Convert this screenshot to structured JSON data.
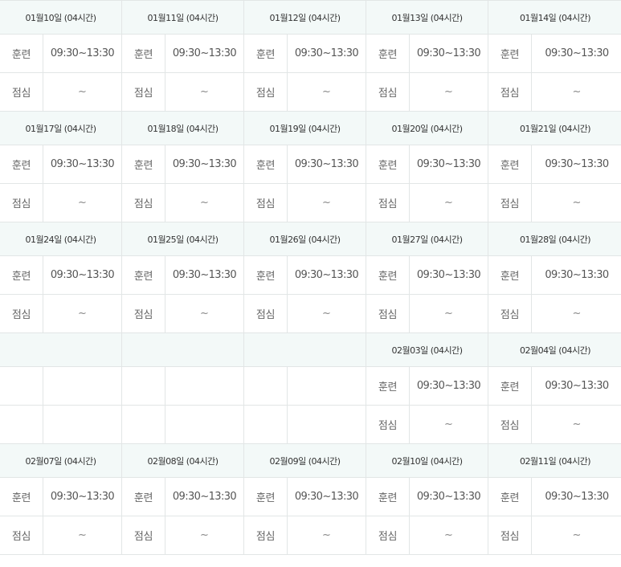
{
  "labels": {
    "training": "훈련",
    "lunch": "점심"
  },
  "weeks": [
    {
      "days": [
        {
          "date": "01월10일 (04시간)",
          "training_time": "09:30~13:30",
          "lunch_time": "~"
        },
        {
          "date": "01월11일 (04시간)",
          "training_time": "09:30~13:30",
          "lunch_time": "~"
        },
        {
          "date": "01월12일 (04시간)",
          "training_time": "09:30~13:30",
          "lunch_time": "~"
        },
        {
          "date": "01월13일 (04시간)",
          "training_time": "09:30~13:30",
          "lunch_time": "~"
        },
        {
          "date": "01월14일 (04시간)",
          "training_time": "09:30~13:30",
          "lunch_time": "~"
        }
      ]
    },
    {
      "days": [
        {
          "date": "01월17일 (04시간)",
          "training_time": "09:30~13:30",
          "lunch_time": "~"
        },
        {
          "date": "01월18일 (04시간)",
          "training_time": "09:30~13:30",
          "lunch_time": "~"
        },
        {
          "date": "01월19일 (04시간)",
          "training_time": "09:30~13:30",
          "lunch_time": "~"
        },
        {
          "date": "01월20일 (04시간)",
          "training_time": "09:30~13:30",
          "lunch_time": "~"
        },
        {
          "date": "01월21일 (04시간)",
          "training_time": "09:30~13:30",
          "lunch_time": "~"
        }
      ]
    },
    {
      "days": [
        {
          "date": "01월24일 (04시간)",
          "training_time": "09:30~13:30",
          "lunch_time": "~"
        },
        {
          "date": "01월25일 (04시간)",
          "training_time": "09:30~13:30",
          "lunch_time": "~"
        },
        {
          "date": "01월26일 (04시간)",
          "training_time": "09:30~13:30",
          "lunch_time": "~"
        },
        {
          "date": "01월27일 (04시간)",
          "training_time": "09:30~13:30",
          "lunch_time": "~"
        },
        {
          "date": "01월28일 (04시간)",
          "training_time": "09:30~13:30",
          "lunch_time": "~"
        }
      ]
    },
    {
      "days": [
        null,
        null,
        null,
        {
          "date": "02월03일 (04시간)",
          "training_time": "09:30~13:30",
          "lunch_time": "~"
        },
        {
          "date": "02월04일 (04시간)",
          "training_time": "09:30~13:30",
          "lunch_time": "~"
        }
      ]
    },
    {
      "days": [
        {
          "date": "02월07일 (04시간)",
          "training_time": "09:30~13:30",
          "lunch_time": "~"
        },
        {
          "date": "02월08일 (04시간)",
          "training_time": "09:30~13:30",
          "lunch_time": "~"
        },
        {
          "date": "02월09일 (04시간)",
          "training_time": "09:30~13:30",
          "lunch_time": "~"
        },
        {
          "date": "02월10일 (04시간)",
          "training_time": "09:30~13:30",
          "lunch_time": "~"
        },
        {
          "date": "02월11일 (04시간)",
          "training_time": "09:30~13:30",
          "lunch_time": "~"
        }
      ]
    }
  ]
}
